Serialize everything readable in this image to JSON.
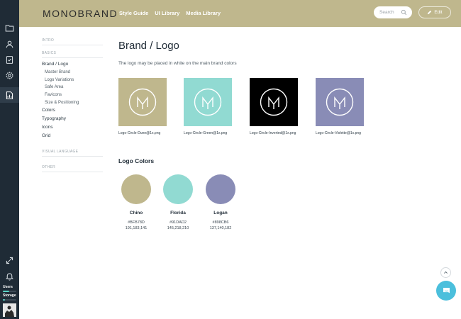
{
  "app": {
    "brand": "MONOBRAND"
  },
  "header": {
    "nav": [
      "Style Guide",
      "UI Library",
      "Media Library"
    ],
    "search_placeholder": "Search",
    "edit_label": "Edit"
  },
  "rail": {
    "icons": [
      "folder-icon",
      "user-icon",
      "checklist-icon",
      "gear-icon",
      "chart-document-icon"
    ],
    "expand_icon": "expand-icon",
    "bell_icon": "bell-icon",
    "users_label": "Users",
    "storage_label": "Storage",
    "users_progress": 0.45,
    "storage_progress": 0.15
  },
  "sidebar": {
    "sections": [
      "INTRO",
      "BASICS",
      "VISUAL LANGUAGE",
      "OTHER"
    ],
    "items": [
      "Brand / Logo",
      "Colors",
      "Typography",
      "Icons",
      "Grid"
    ],
    "subitems": [
      "Master Brand",
      "Logo Variations",
      "Safe Area",
      "Favicons",
      "Size & Positioning"
    ]
  },
  "main": {
    "title": "Brand / Logo",
    "description": "The logo may be placed in white on the main brand colors",
    "logos": [
      {
        "file": "Logo-Circle-Dune@1x.png",
        "bg": "#bfb78d"
      },
      {
        "file": "Logo-Circle-Green@1x.png",
        "bg": "#91dad2"
      },
      {
        "file": "Logo-Circle-Inverted@1x.png",
        "bg": "#000000"
      },
      {
        "file": "Logo-Circle-Violette@1x.png",
        "bg": "#898cb6"
      }
    ],
    "colors_heading": "Logo Colors",
    "colors": [
      {
        "name": "Chino",
        "hex": "#BFB78D",
        "rgb": "191,183,141",
        "color": "#bfb78d"
      },
      {
        "name": "Florida",
        "hex": "#91DAD2",
        "rgb": "145,218,210",
        "color": "#91dad2"
      },
      {
        "name": "Logan",
        "hex": "#898CB6",
        "rgb": "137,140,182",
        "color": "#898cb6"
      }
    ]
  }
}
